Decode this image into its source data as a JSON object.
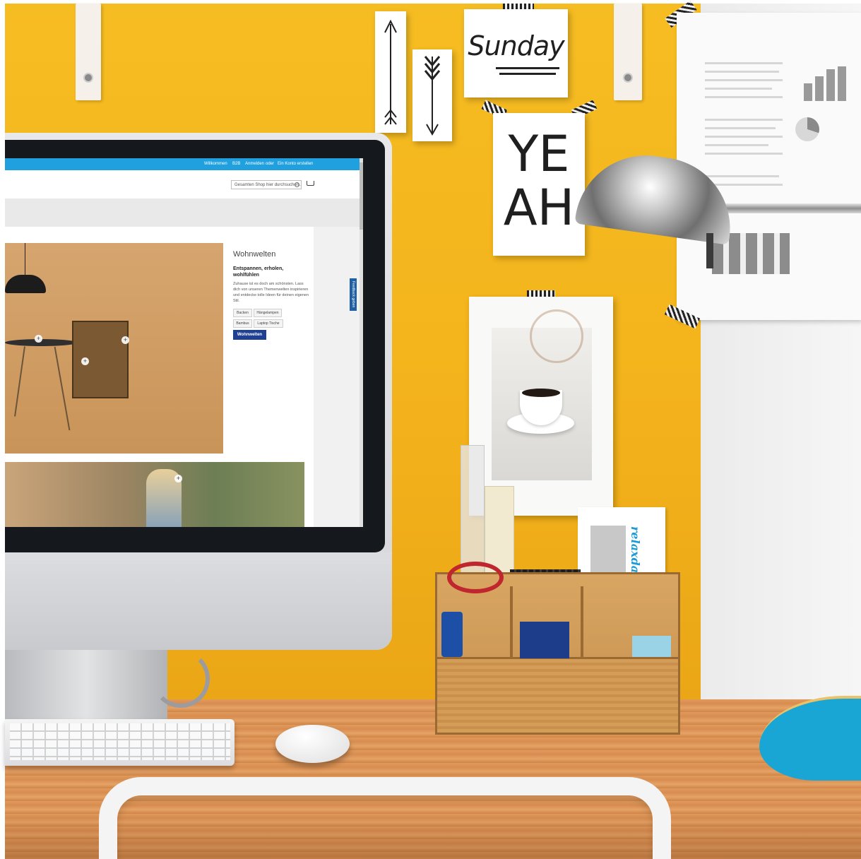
{
  "wall": {
    "note_sunday": "Sunday",
    "note_yeah_line1": "YE",
    "note_yeah_line2": "AH"
  },
  "website": {
    "topbar_links": [
      "Willkommen",
      "B2B",
      "Anmelden",
      "oder",
      "Ein Konto erstellen"
    ],
    "search_placeholder": "Gesamten Shop hier durchsuchen...",
    "feedback_tab": "Feedback geben",
    "section_title": "Wohnwelten",
    "section_subtitle": "Entspannen, erholen, wohlfühlen",
    "section_body": "Zuhause ist es doch am schönsten. Lass dich von unseren Themenwelten inspirieren und entdecke tolle Ideen für deinen eigenen Stil.",
    "tags": [
      "Backen",
      "Hängelampen",
      "Bambus",
      "Laptop Tische"
    ],
    "cta_label": "Wohnwelten"
  },
  "organizer": {
    "brand": "relaxdays"
  },
  "colors": {
    "wall_yellow": "#f3b21b",
    "topbar_blue": "#21a0e0",
    "cta_blue": "#1f3f92",
    "brand_blue": "#1b9bd6"
  },
  "icons": [
    "search-icon",
    "cart-icon",
    "plus-icon",
    "arrow-up-icon",
    "arrow-down-icon"
  ]
}
